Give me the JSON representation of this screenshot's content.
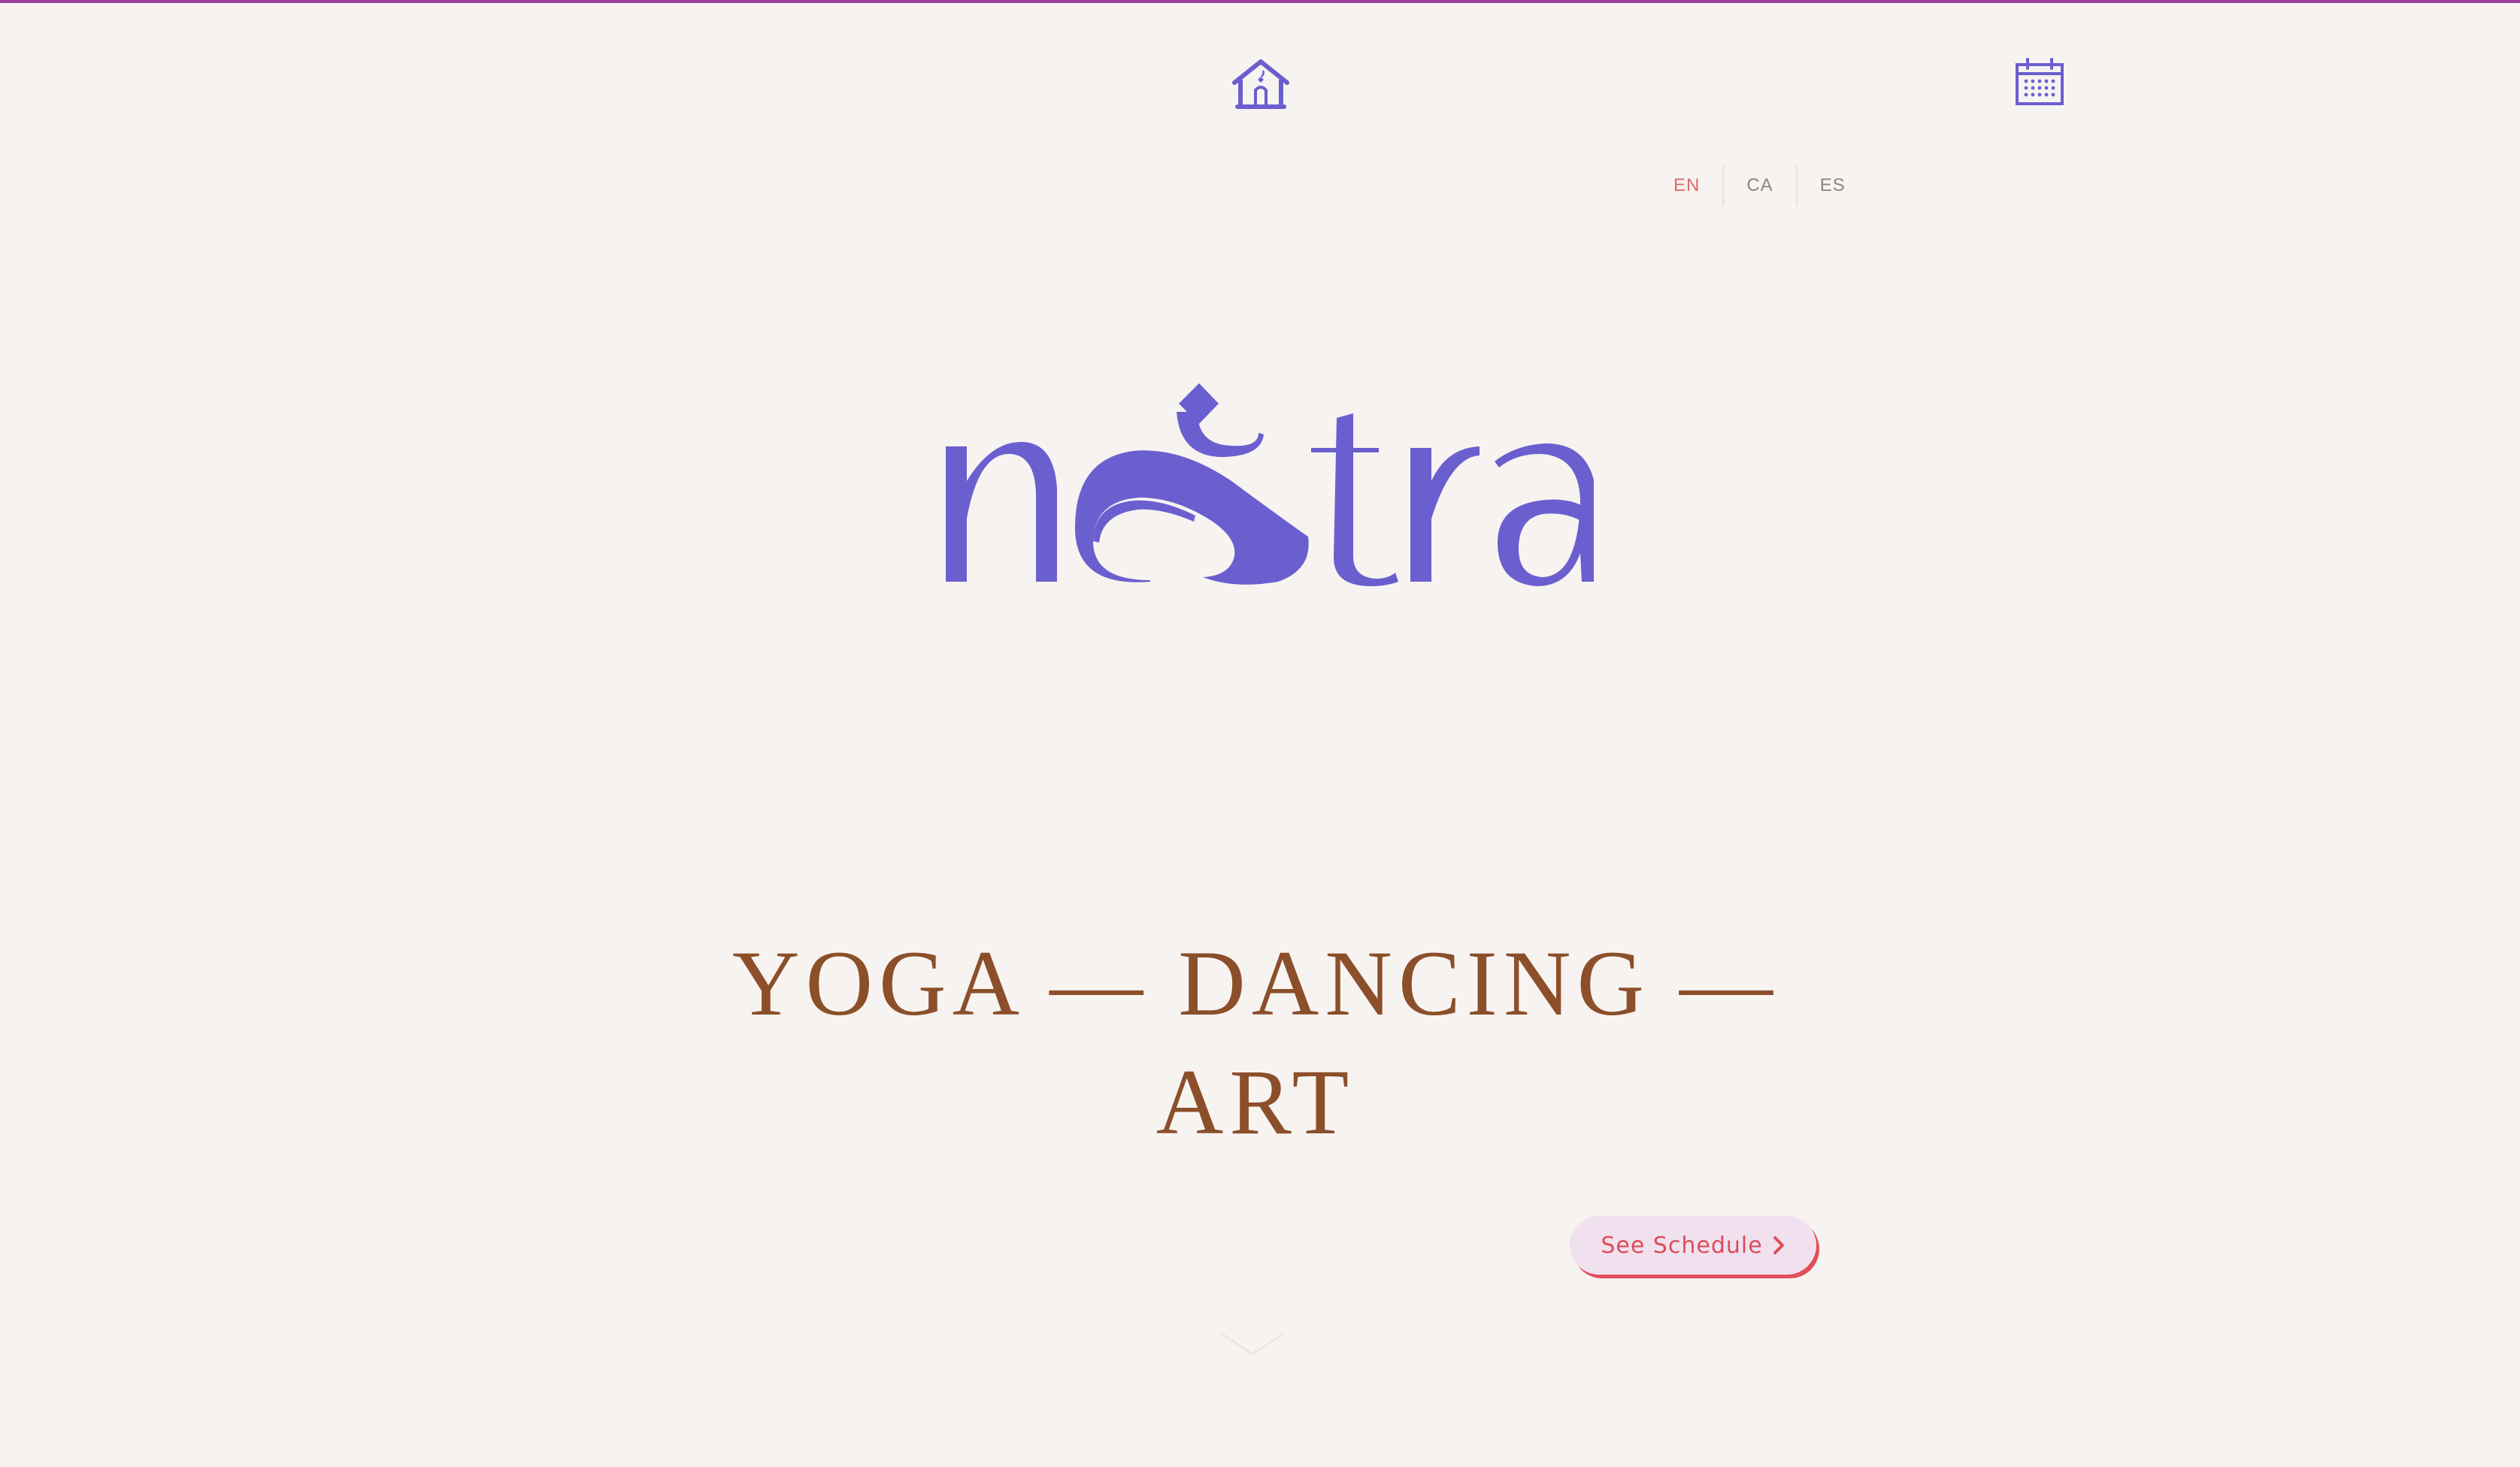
{
  "colors": {
    "background": "#f7f3f1",
    "top_accent": "#9b3fa0",
    "brand_purple": "#6b5fcf",
    "tagline_brown": "#8b4f2a",
    "accent_red": "#df4c5a",
    "button_bg": "#f1e1ef",
    "lang_active": "#e06a6a",
    "lang_inactive": "#8d8583"
  },
  "header": {
    "home_icon": "home-icon",
    "calendar_icon": "calendar-icon"
  },
  "languages": {
    "active": "EN",
    "items": [
      "EN",
      "CA",
      "ES"
    ]
  },
  "brand": {
    "logo_text": "nestra"
  },
  "hero": {
    "tagline": "YOGA — DANCING — ART",
    "cta_label": "See Schedule",
    "cta_icon": "chevron-right-icon",
    "scroll_icon": "chevron-down-icon"
  }
}
